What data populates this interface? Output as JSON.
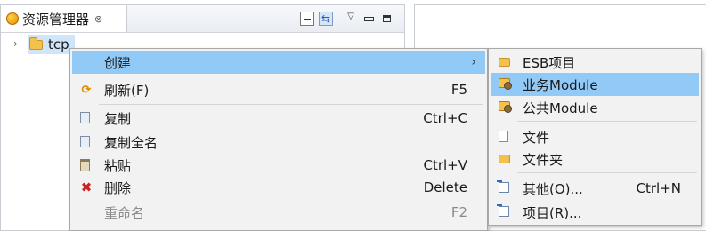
{
  "explorer": {
    "tab_title": "资源管理器",
    "tab_close": "⊗",
    "view_menu_glyph": "▽",
    "tree_root": "tcp",
    "tree_twisty": "›"
  },
  "context_menu": {
    "items": [
      {
        "label": "创建",
        "accel": "",
        "has_submenu": true,
        "icon": "none",
        "enabled": true,
        "highlighted": true
      },
      {
        "label": "刷新(F)",
        "accel": "F5",
        "icon": "refresh-icon",
        "enabled": true
      },
      {
        "label": "复制",
        "accel": "Ctrl+C",
        "icon": "copy-icon",
        "enabled": true
      },
      {
        "label": "复制全名",
        "accel": "",
        "icon": "copy-fullname-icon",
        "enabled": true
      },
      {
        "label": "粘贴",
        "accel": "Ctrl+V",
        "icon": "paste-icon",
        "enabled": true
      },
      {
        "label": "删除",
        "accel": "Delete",
        "icon": "delete-icon",
        "enabled": true
      },
      {
        "label": "重命名",
        "accel": "F2",
        "icon": "none",
        "enabled": false
      }
    ],
    "submenu_arrow": "›"
  },
  "submenu": {
    "items": [
      {
        "label": "ESB项目",
        "accel": "",
        "icon": "esb-project-icon"
      },
      {
        "label": "业务Module",
        "accel": "",
        "icon": "business-module-icon",
        "highlighted": true
      },
      {
        "label": "公共Module",
        "accel": "",
        "icon": "common-module-icon"
      },
      {
        "label": "文件",
        "accel": "",
        "icon": "file-icon"
      },
      {
        "label": "文件夹",
        "accel": "",
        "icon": "folder-icon"
      },
      {
        "label": "其他(O)...",
        "accel": "Ctrl+N",
        "icon": "other-icon"
      },
      {
        "label": "项目(R)...",
        "accel": "",
        "icon": "project-icon"
      }
    ]
  },
  "colors": {
    "highlight": "#91c9f7",
    "selection": "#cfe5f9",
    "menu_bg": "#f2f2f2",
    "delete_icon": "#d02020"
  }
}
